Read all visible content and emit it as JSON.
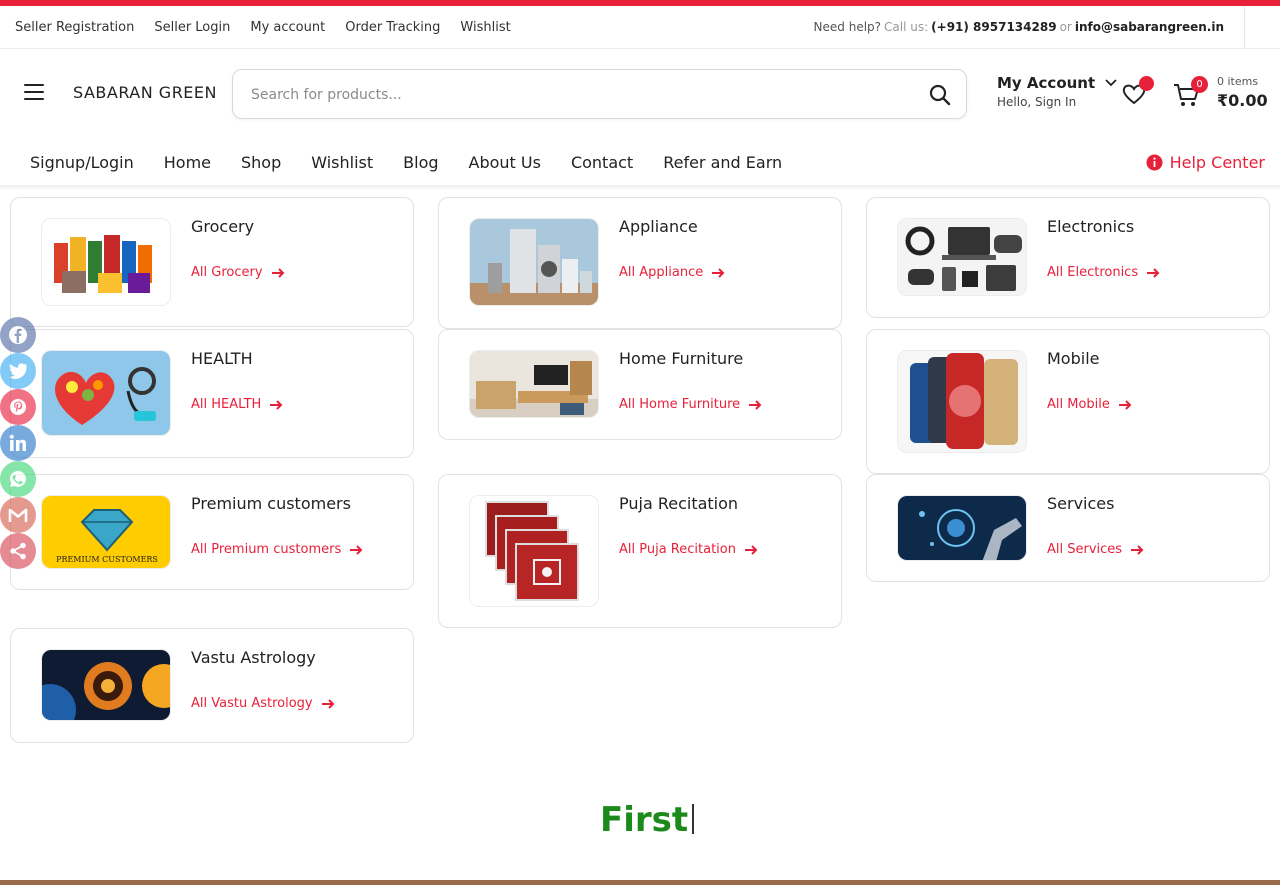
{
  "topbar": {
    "links": [
      "Seller Registration",
      "Seller Login",
      "My account",
      "Order Tracking",
      "Wishlist"
    ],
    "help_prefix": "Need help?",
    "call_label": "Call us:",
    "phone": "(+91) 8957134289",
    "or": "or",
    "email": "info@sabarangreen.in"
  },
  "header": {
    "brand": "SABARAN GREEN",
    "search_placeholder": "Search for products...",
    "account_title": "My Account",
    "account_sub": "Hello, Sign In",
    "cart_count": "0",
    "cart_items": "0 items",
    "cart_total": "₹0.00"
  },
  "nav": {
    "items": [
      "Signup/Login",
      "Home",
      "Shop",
      "Wishlist",
      "Blog",
      "About Us",
      "Contact",
      "Refer and Earn"
    ],
    "help_center": "Help Center"
  },
  "categories": [
    {
      "name": "Grocery",
      "link": "All Grocery"
    },
    {
      "name": "Appliance",
      "link": "All Appliance"
    },
    {
      "name": "Electronics",
      "link": "All Electronics"
    },
    {
      "name": "HEALTH",
      "link": "All HEALTH"
    },
    {
      "name": "Home Furniture",
      "link": "All Home Furniture"
    },
    {
      "name": "Mobile",
      "link": "All Mobile"
    },
    {
      "name": "Premium customers",
      "link": "All Premium customers"
    },
    {
      "name": "Puja Recitation",
      "link": "All Puja Recitation"
    },
    {
      "name": "Services",
      "link": "All Services"
    },
    {
      "name": "Vastu Astrology",
      "link": "All Vastu Astrology"
    }
  ],
  "images": {
    "premium_text": "PREMIUM CUSTOMERS"
  },
  "social": [
    "facebook-icon",
    "twitter-icon",
    "pinterest-icon",
    "linkedin-icon",
    "whatsapp-icon",
    "gmail-icon",
    "share-icon"
  ],
  "headline": "First",
  "colors": {
    "accent": "#e8213a",
    "headline": "#1b8a1b"
  }
}
